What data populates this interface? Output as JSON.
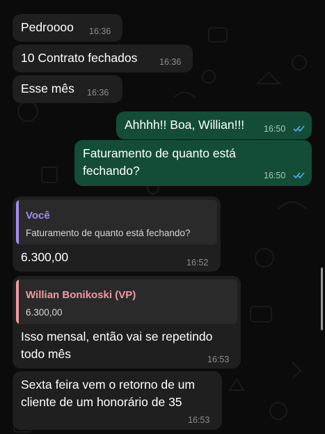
{
  "chat": {
    "messages": [
      {
        "text": "Pedroooo",
        "time": "16:36"
      },
      {
        "text": "10 Contrato fechados",
        "time": "16:36"
      },
      {
        "text": "Esse mês",
        "time": "16:36"
      },
      {
        "text": "Ahhhh!! Boa, Willian!!!",
        "time": "16:50",
        "status": "read"
      },
      {
        "text_lines": [
          "Faturamento de quanto está",
          "fechando?"
        ],
        "time": "16:50",
        "status": "read"
      },
      {
        "reply_to": {
          "author": "Você",
          "text": "Faturamento de quanto está fechando?"
        },
        "text": "6.300,00",
        "time": "16:52"
      },
      {
        "reply_to": {
          "author": "Willian Bonikoski (VP)",
          "text": "6.300,00"
        },
        "text_lines": [
          "Isso mensal, então vai se repetindo",
          "todo mês"
        ],
        "time": "16:53"
      },
      {
        "text_lines": [
          "Sexta feira vem o retorno de um",
          "cliente de um honorário de 35"
        ],
        "time": "16:53"
      }
    ]
  },
  "colors": {
    "incoming_bubble": "#1f1f1f",
    "outgoing_bubble": "#134d37",
    "read_ticks": "#5aaaf0",
    "reply_you": "#a48cf0",
    "reply_willian": "#f09aa0"
  }
}
